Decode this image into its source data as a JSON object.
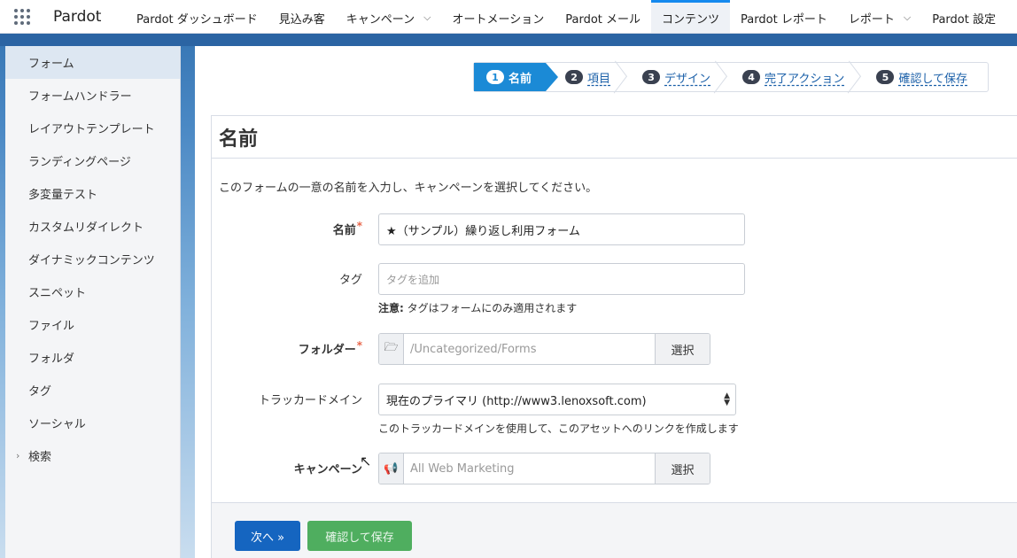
{
  "app": {
    "name": "Pardot"
  },
  "nav": {
    "items": [
      {
        "label": "Pardot ダッシュボード",
        "chevron": false,
        "active": false
      },
      {
        "label": "見込み客",
        "chevron": false,
        "active": false
      },
      {
        "label": "キャンペーン",
        "chevron": true,
        "active": false
      },
      {
        "label": "オートメーション",
        "chevron": false,
        "active": false
      },
      {
        "label": "Pardot メール",
        "chevron": false,
        "active": false
      },
      {
        "label": "コンテンツ",
        "chevron": false,
        "active": true
      },
      {
        "label": "Pardot レポート",
        "chevron": false,
        "active": false
      },
      {
        "label": "レポート",
        "chevron": true,
        "active": false
      },
      {
        "label": "Pardot 設定",
        "chevron": false,
        "active": false
      }
    ]
  },
  "sidebar": {
    "items": [
      {
        "label": "フォーム",
        "active": true
      },
      {
        "label": "フォームハンドラー"
      },
      {
        "label": "レイアウトテンプレート"
      },
      {
        "label": "ランディングページ"
      },
      {
        "label": "多変量テスト"
      },
      {
        "label": "カスタムリダイレクト"
      },
      {
        "label": "ダイナミックコンテンツ"
      },
      {
        "label": "スニペット"
      },
      {
        "label": "ファイル"
      },
      {
        "label": "フォルダ"
      },
      {
        "label": "タグ"
      },
      {
        "label": "ソーシャル"
      },
      {
        "label": "検索",
        "expandable": true
      }
    ]
  },
  "wizard": {
    "steps": [
      {
        "num": "1",
        "label": "名前",
        "active": true
      },
      {
        "num": "2",
        "label": "項目"
      },
      {
        "num": "3",
        "label": "デザイン"
      },
      {
        "num": "4",
        "label": "完了アクション"
      },
      {
        "num": "5",
        "label": "確認して保存"
      }
    ]
  },
  "form": {
    "title": "名前",
    "description": "このフォームの一意の名前を入力し、キャンペーンを選択してください。",
    "name": {
      "label": "名前",
      "required_mark": "*",
      "value": "★（サンプル）繰り返し利用フォーム"
    },
    "tag": {
      "label": "タグ",
      "placeholder": "タグを追加",
      "note_bold": "注意:",
      "note": " タグはフォームにのみ適用されます"
    },
    "folder": {
      "label": "フォルダー",
      "required_mark": "*",
      "value": "/Uncategorized/Forms",
      "button": "選択"
    },
    "tracker": {
      "label": "トラッカードメイン",
      "value": "現在のプライマリ (http://www3.lenoxsoft.com)",
      "note": "このトラッカードメインを使用して、このアセットへのリンクを作成します"
    },
    "campaign": {
      "label": "キャンペーン",
      "value": "All Web Marketing",
      "button": "選択"
    }
  },
  "footer": {
    "next_label": "次へ »",
    "save_label": "確認して保存"
  },
  "colors": {
    "accent": "#1b8ad6",
    "next_button": "#1565c0",
    "save_button": "#4fae5f",
    "required": "#e8664a"
  }
}
